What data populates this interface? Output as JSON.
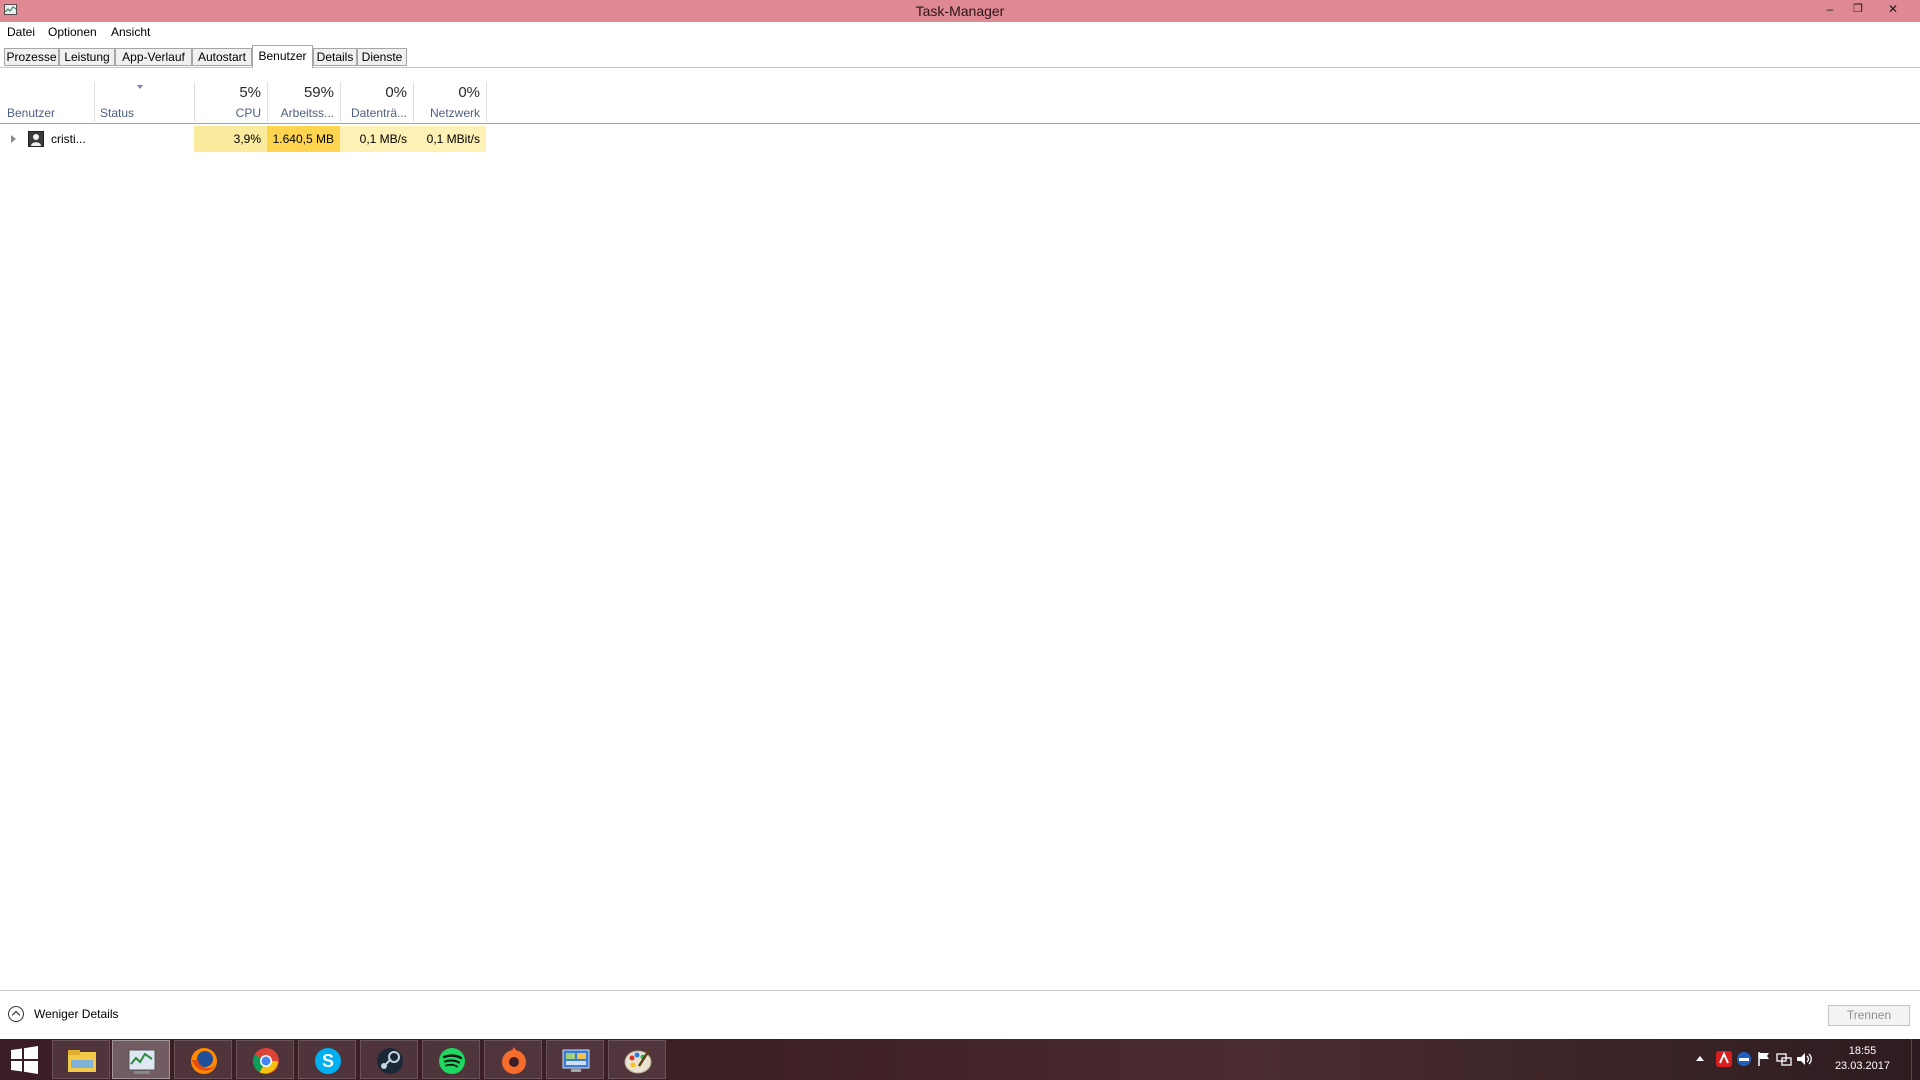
{
  "window": {
    "title": "Task-Manager",
    "controls": {
      "minimize": "–",
      "restore": "❐",
      "close": "✕"
    }
  },
  "menu": [
    "Datei",
    "Optionen",
    "Ansicht"
  ],
  "tabs": [
    "Prozesse",
    "Leistung",
    "App-Verlauf",
    "Autostart",
    "Benutzer",
    "Details",
    "Dienste"
  ],
  "active_tab": "Benutzer",
  "columns": {
    "user": {
      "label": "Benutzer"
    },
    "status": {
      "label": "Status"
    },
    "cpu": {
      "percent": "5%",
      "label": "CPU"
    },
    "memory": {
      "percent": "59%",
      "label": "Arbeitss..."
    },
    "disk": {
      "percent": "0%",
      "label": "Datenträ..."
    },
    "network": {
      "percent": "0%",
      "label": "Netzwerk"
    }
  },
  "rows": [
    {
      "user": "cristi...",
      "status": "",
      "cpu": "3,9%",
      "memory": "1.640,5 MB",
      "disk": "0,1 MB/s",
      "network": "0,1 MBit/s"
    }
  ],
  "colors": {
    "titlebar": "#de8993",
    "heat_light": "#fff4c4",
    "heat_cpu": "#fbeb9e",
    "heat_memory": "#ffd54f",
    "heat_disk": "#fdf1b5"
  },
  "footer": {
    "less_details": "Weniger Details",
    "disconnect": "Trennen"
  },
  "taskbar": {
    "apps": [
      "windows-start",
      "file-explorer",
      "task-manager",
      "firefox",
      "chrome",
      "skype",
      "steam",
      "spotify",
      "origin",
      "control-panel",
      "paint"
    ],
    "clock_time": "18:55",
    "clock_date": "23.03.2017"
  }
}
